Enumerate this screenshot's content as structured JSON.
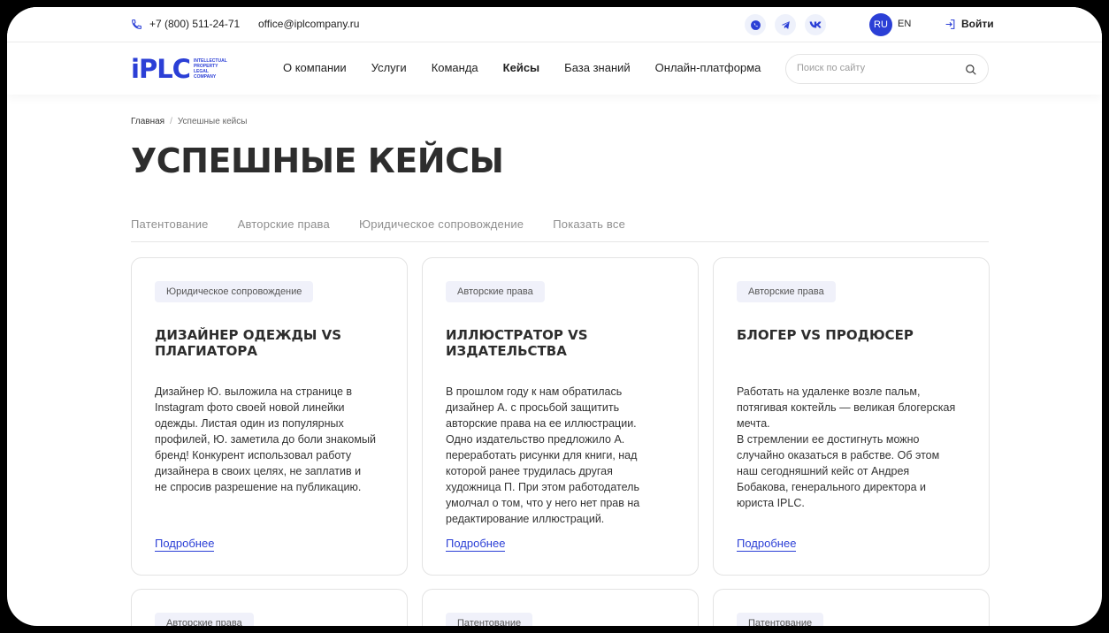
{
  "topbar": {
    "phone": "+7 (800) 511-24-71",
    "email": "office@iplcompany.ru",
    "socials": [
      "whatsapp-icon",
      "telegram-icon",
      "vk-icon"
    ],
    "lang_ru": "RU",
    "lang_en": "EN",
    "login": "Войти"
  },
  "logo": {
    "mark": "iPLC",
    "sub": "INTELLECTUAL PROPERTY LEGAL COMPANY"
  },
  "nav": {
    "items": [
      "О компании",
      "Услуги",
      "Команда",
      "Кейсы",
      "База знаний",
      "Онлайн-платформа"
    ],
    "active": "Кейсы"
  },
  "search": {
    "placeholder": "Поиск по сайту"
  },
  "breadcrumb": {
    "home": "Главная",
    "sep": "/",
    "current": "Успешные кейсы"
  },
  "page_title": "УСПЕШНЫЕ КЕЙСЫ",
  "filters": [
    "Патентование",
    "Авторские права",
    "Юридическое сопровождение",
    "Показать все"
  ],
  "cards": [
    {
      "tag": "Юридическое сопровождение",
      "title": "Дизайнер одежды VS плагиатора",
      "desc": "Дизайнер Ю. выложила на странице в\nInstagram фото своей новой линейки\nодежды. Листая один из популярных\nпрофилей, Ю. заметила до боли знакомый\nбренд! Конкурент использовал работу\nдизайнера в своих целях, не заплатив и\nне спросив разрешение на публикацию.",
      "more": "Подробнее"
    },
    {
      "tag": "Авторские права",
      "title": "Иллюстратор VS издательства",
      "desc": "В прошлом году к нам обратилась\nдизайнер А. с просьбой защитить\nавторские права на ее иллюстрации.\nОдно издательство предложило А.\nпереработать рисунки для книги, над\nкоторой ранее трудилась другая\nхудожница П. При этом работодатель\nумолчал о том, что у него нет прав на\nредактирование иллюстраций.",
      "more": "Подробнее"
    },
    {
      "tag": "Авторские права",
      "title": "Блогер VS продюсер",
      "desc": "Работать на удаленке возле пальм,\nпотягивая коктейль — великая блогерская\nмечта.\nВ стремлении ее достигнуть можно\nслучайно оказаться в рабстве. Об этом\nнаш сегодняшний кейс от Андрея\nБобакова, генерального директора и\nюриста IPLC.",
      "more": "Подробнее"
    }
  ],
  "cards_row2": [
    {
      "tag": "Авторские права"
    },
    {
      "tag": "Патентование"
    },
    {
      "tag": "Патентование"
    }
  ],
  "colors": {
    "accent": "#2b3fd6",
    "tag_bg": "#f0f1fa",
    "frame_bg": "#000000"
  }
}
